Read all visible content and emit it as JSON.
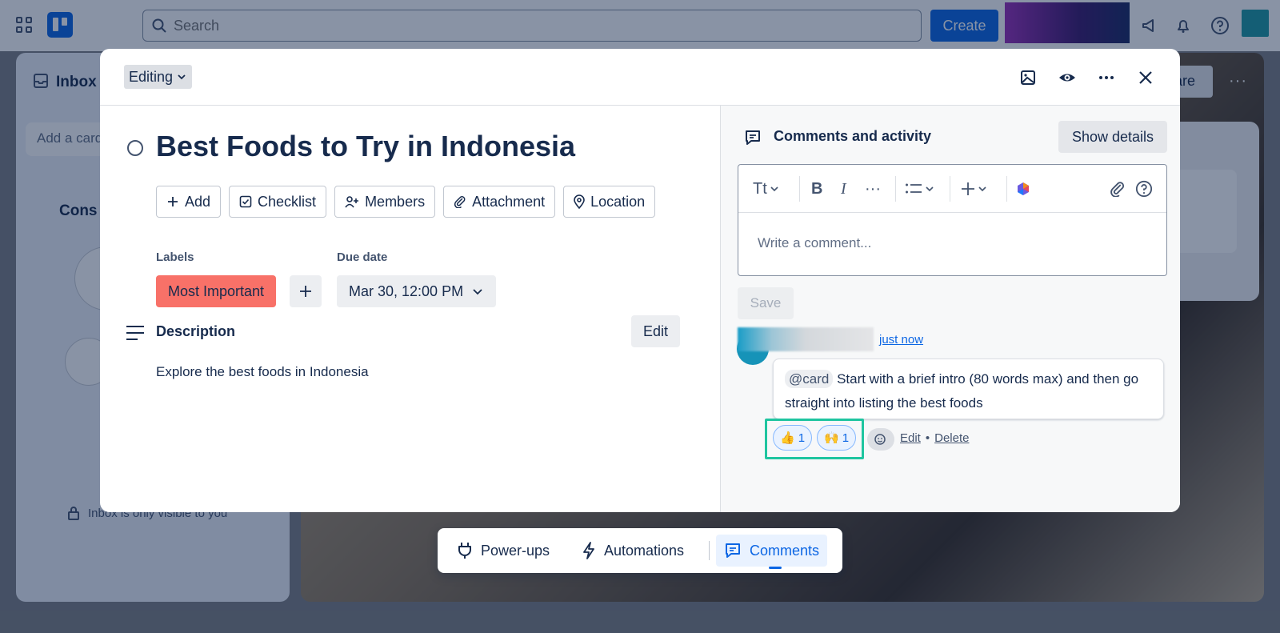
{
  "topbar": {
    "search_placeholder": "Search",
    "create_label": "Create"
  },
  "background": {
    "inbox_title": "Inbox",
    "add_card_placeholder": "Add a card",
    "section_title": "Cons",
    "inbox_footer": "Inbox is only visible to you",
    "share_label": "are"
  },
  "modal": {
    "editing_label": "Editing",
    "title": "Best Foods to Try in Indonesia",
    "actions": [
      {
        "label": "Add",
        "icon": "plus-icon"
      },
      {
        "label": "Checklist",
        "icon": "checklist-icon"
      },
      {
        "label": "Members",
        "icon": "add-person-icon"
      },
      {
        "label": "Attachment",
        "icon": "paperclip-icon"
      },
      {
        "label": "Location",
        "icon": "location-pin-icon"
      }
    ],
    "labels_heading": "Labels",
    "label_chip": "Most Important",
    "label_color": "#f87168",
    "due_heading": "Due date",
    "due_value": "Mar 30, 12:00 PM",
    "description_title": "Description",
    "description_edit": "Edit",
    "description_text": "Explore the best foods in Indonesia"
  },
  "activity": {
    "title": "Comments and activity",
    "show_details": "Show details",
    "toolbar": {
      "text_style": "Tt",
      "bold": "B",
      "italic": "I",
      "more": "···"
    },
    "comment_placeholder": "Write a comment...",
    "save_label": "Save",
    "comment": {
      "time": "just now",
      "mention": "@card",
      "text": "Start with a brief intro (80 words max) and then go straight into listing the best foods",
      "reactions": [
        {
          "emoji": "👍",
          "count": "1"
        },
        {
          "emoji": "🙌",
          "count": "1"
        }
      ],
      "edit_label": "Edit",
      "separator": "•",
      "delete_label": "Delete"
    }
  },
  "dock": {
    "items": [
      {
        "label": "Power-ups"
      },
      {
        "label": "Automations"
      },
      {
        "label": "Comments"
      }
    ]
  },
  "colors": {
    "accent": "#0c66e4",
    "highlight": "#1fc5a0"
  }
}
